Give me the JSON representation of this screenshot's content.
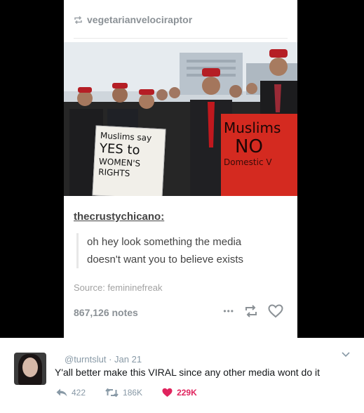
{
  "post": {
    "reblog_user": "vegetarianvelociraptor",
    "photo": {
      "sign_left_lines": [
        "Muslims say",
        "YES to",
        "WOMEN'S RIGHTS"
      ],
      "sign_right_lines": [
        "Muslims",
        "NO",
        "Domestic V"
      ]
    },
    "commenter": "thecrustychicano",
    "colon": ":",
    "quote_line1": "oh hey look something the media",
    "quote_line2": "doesn't want you to believe exists",
    "source": "Source: femininefreak",
    "notes": "867,126 notes",
    "more_label": "•••"
  },
  "tweet": {
    "handle": "@turntslut",
    "date": "· Jan 21",
    "text": "Y'all better make this VIRAL since any other media wont do it",
    "replies": "422",
    "retweets": "186K",
    "likes": "229K"
  },
  "colors": {
    "background": "#000000",
    "card": "#ffffff",
    "like": "#e0245e",
    "muted": "#8899a6",
    "sign_red": "#d42a20"
  }
}
